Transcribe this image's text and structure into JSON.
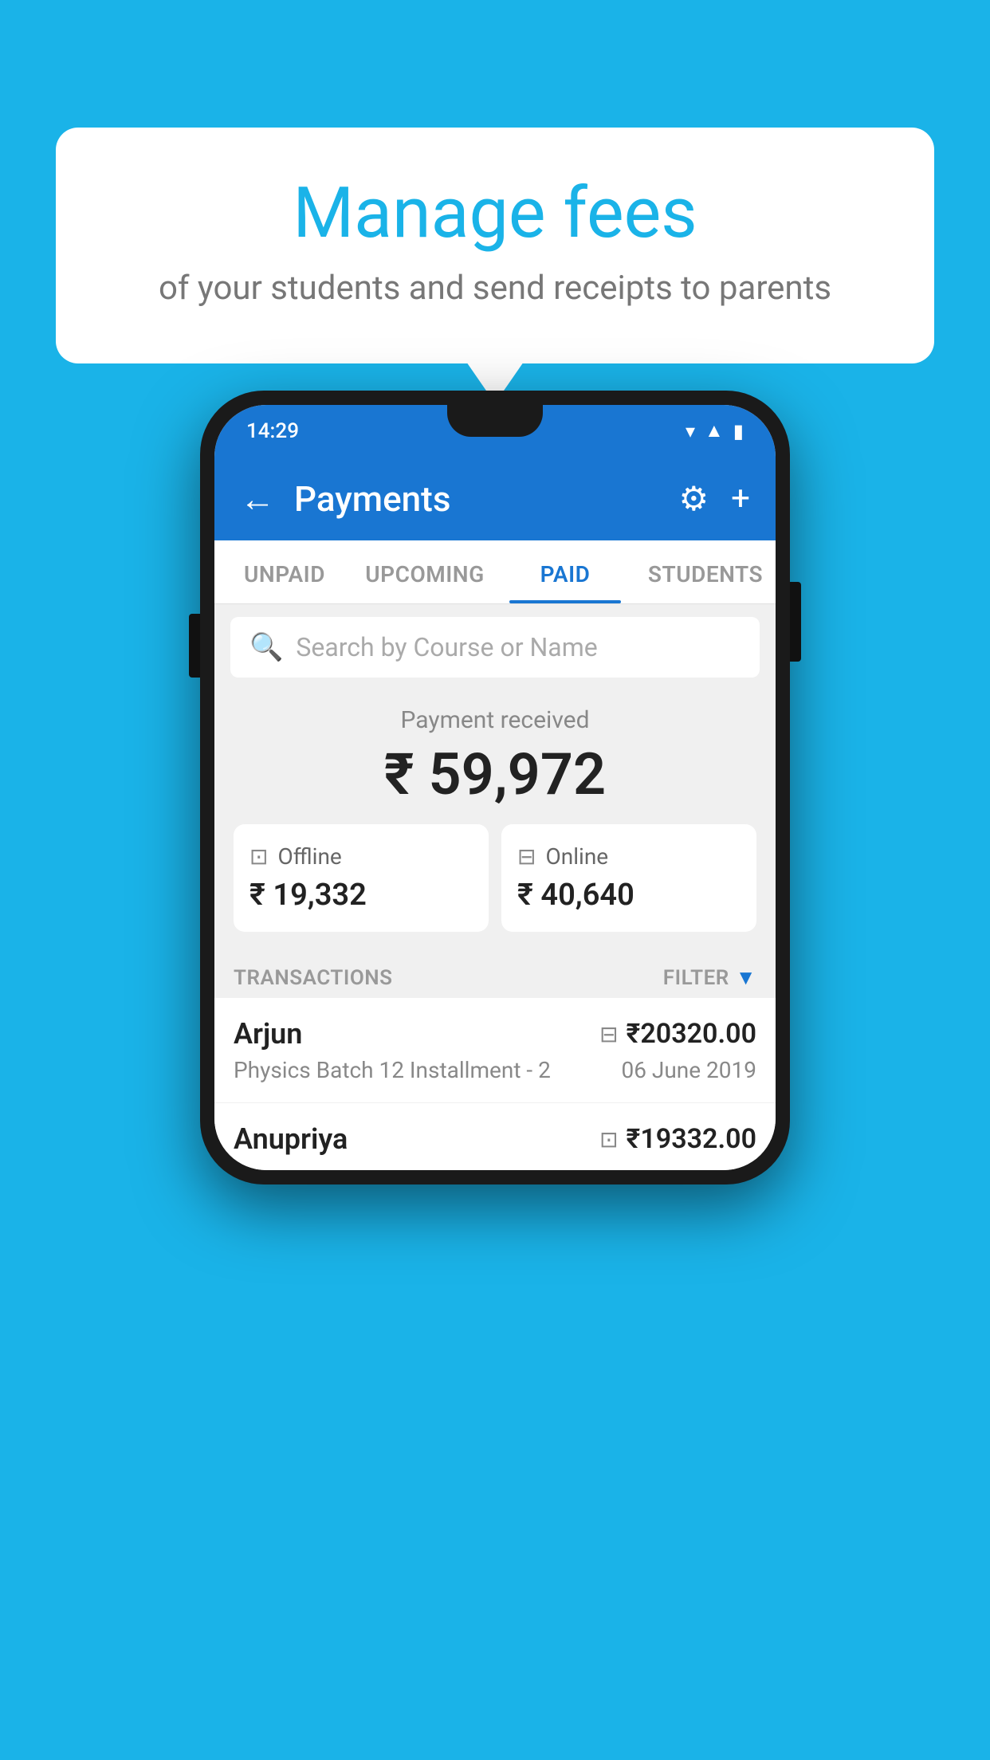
{
  "background_color": "#1ab3e8",
  "speech_bubble": {
    "title": "Manage fees",
    "subtitle": "of your students and send receipts to parents"
  },
  "phone": {
    "status_bar": {
      "time": "14:29"
    },
    "app_bar": {
      "title": "Payments",
      "back_label": "←",
      "gear_icon": "⚙",
      "plus_icon": "+"
    },
    "tabs": [
      {
        "label": "UNPAID",
        "active": false
      },
      {
        "label": "UPCOMING",
        "active": false
      },
      {
        "label": "PAID",
        "active": true
      },
      {
        "label": "STUDENTS",
        "active": false
      }
    ],
    "search": {
      "placeholder": "Search by Course or Name"
    },
    "payment_summary": {
      "label": "Payment received",
      "amount": "₹ 59,972",
      "offline_label": "Offline",
      "offline_amount": "₹ 19,332",
      "online_label": "Online",
      "online_amount": "₹ 40,640"
    },
    "transactions_section": {
      "header": "TRANSACTIONS",
      "filter_label": "FILTER"
    },
    "transactions": [
      {
        "name": "Arjun",
        "amount": "₹20320.00",
        "type": "online",
        "course": "Physics Batch 12 Installment - 2",
        "date": "06 June 2019"
      },
      {
        "name": "Anupriya",
        "amount": "₹19332.00",
        "type": "offline",
        "course": "",
        "date": ""
      }
    ]
  }
}
